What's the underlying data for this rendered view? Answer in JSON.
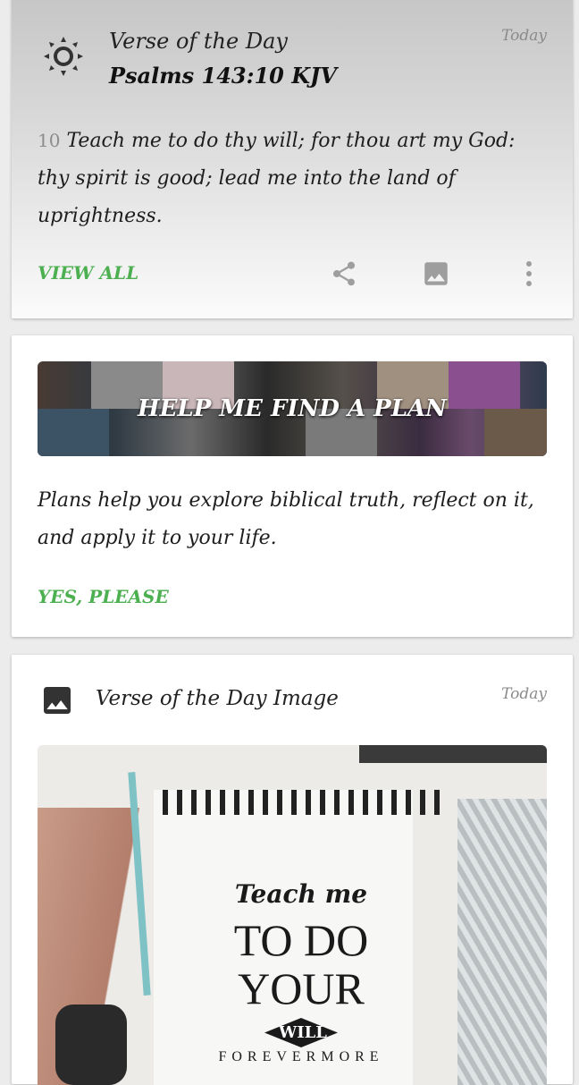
{
  "verse_card": {
    "title": "Verse of the Day",
    "reference": "Psalms 143:10 KJV",
    "date": "Today",
    "verse_number": "10",
    "verse_text": "Teach me to do thy will; for thou art my God: thy spirit is good; lead me into the land of uprightness.",
    "view_all_label": "VIEW ALL",
    "icons": [
      "sun-icon",
      "share-icon",
      "image-icon",
      "more-vert-icon"
    ]
  },
  "plan_card": {
    "banner_label": "HELP ME FIND A PLAN",
    "description": "Plans help you explore biblical truth, reflect on it, and apply it to your life.",
    "yes_label": "YES, PLEASE"
  },
  "image_card": {
    "title": "Verse of the Day Image",
    "date": "Today",
    "icon": "image-icon",
    "image_lettering": {
      "line1": "Teach me",
      "line2": "TO DO",
      "line3": "YOUR",
      "line4": "WILL",
      "line5": "FOREVERMORE"
    }
  },
  "colors": {
    "accent": "#4caf50",
    "icon_gray": "#9e9e9e"
  }
}
